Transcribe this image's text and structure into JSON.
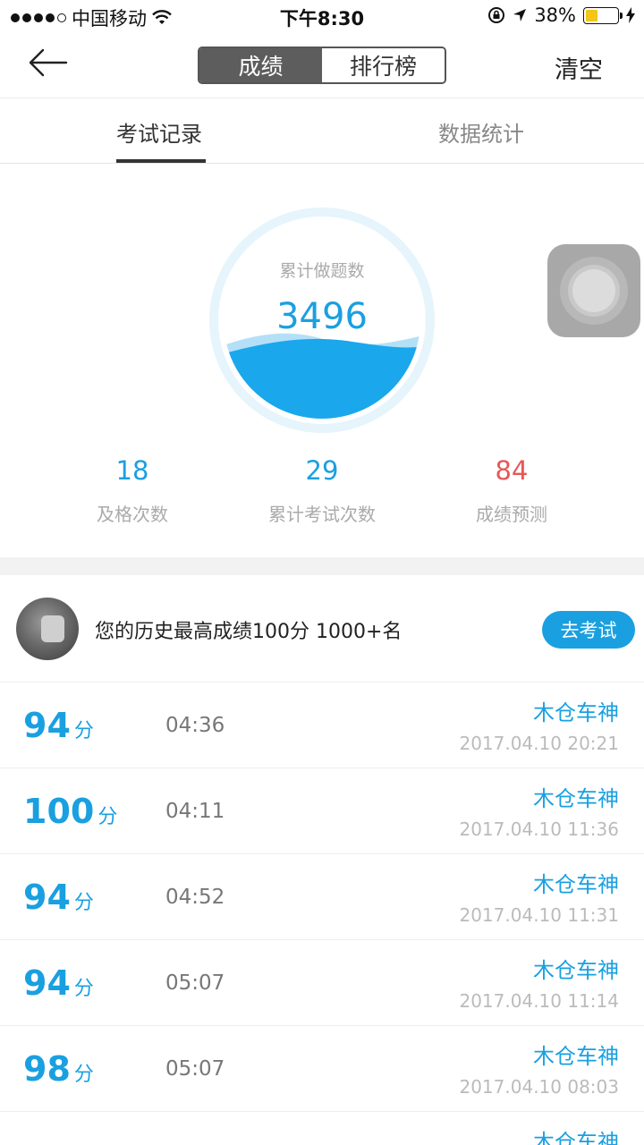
{
  "status_bar": {
    "carrier": "中国移动",
    "time": "下午8:30",
    "battery": "38%",
    "battery_level": 0.38
  },
  "nav": {
    "segments": [
      "成绩",
      "排行榜"
    ],
    "clear": "清空"
  },
  "tabs": [
    "考试记录",
    "数据统计"
  ],
  "gauge": {
    "label": "累计做题数",
    "value": "3496"
  },
  "stats": [
    {
      "value": "18",
      "label": "及格次数"
    },
    {
      "value": "29",
      "label": "累计考试次数"
    },
    {
      "value": "84",
      "label": "成绩预测"
    }
  ],
  "best": {
    "text": "您的历史最高成绩100分 1000+名",
    "button": "去考试"
  },
  "records": [
    {
      "score": "94",
      "unit": "分",
      "duration": "04:36",
      "name": "木仓车神",
      "datetime": "2017.04.10 20:21"
    },
    {
      "score": "100",
      "unit": "分",
      "duration": "04:11",
      "name": "木仓车神",
      "datetime": "2017.04.10 11:36"
    },
    {
      "score": "94",
      "unit": "分",
      "duration": "04:52",
      "name": "木仓车神",
      "datetime": "2017.04.10 11:31"
    },
    {
      "score": "94",
      "unit": "分",
      "duration": "05:07",
      "name": "木仓车神",
      "datetime": "2017.04.10 11:14"
    },
    {
      "score": "98",
      "unit": "分",
      "duration": "05:07",
      "name": "木仓车神",
      "datetime": "2017.04.10 08:03"
    },
    {
      "name": "木仓车神"
    }
  ],
  "colors": {
    "accent": "#1aa0e0",
    "prediction": "#e85656",
    "segment_active": "#5d5d5d"
  }
}
